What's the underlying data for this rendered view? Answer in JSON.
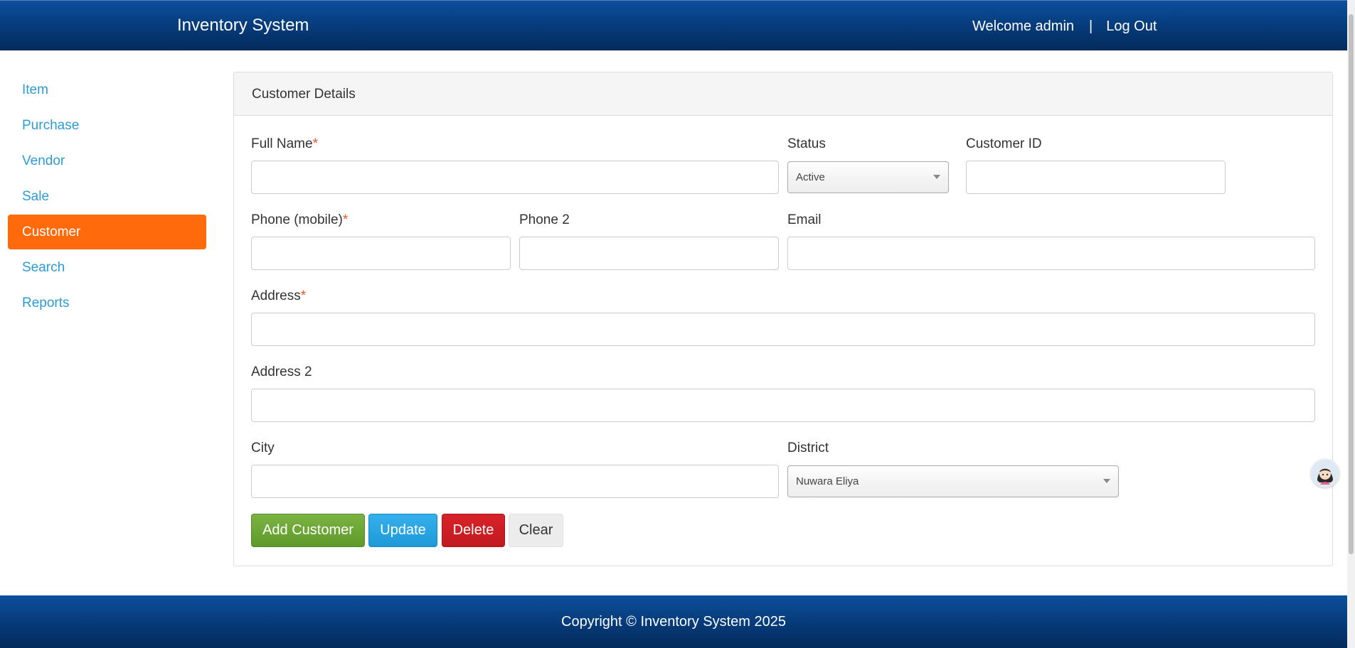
{
  "header": {
    "brand": "Inventory System",
    "welcome": "Welcome admin",
    "separator": "|",
    "logout": "Log Out"
  },
  "sidebar": {
    "items": [
      {
        "label": "Item"
      },
      {
        "label": "Purchase"
      },
      {
        "label": "Vendor"
      },
      {
        "label": "Sale"
      },
      {
        "label": "Customer",
        "active": true
      },
      {
        "label": "Search"
      },
      {
        "label": "Reports"
      }
    ]
  },
  "form": {
    "title": "Customer Details",
    "required_mark": "*",
    "full_name": {
      "label": "Full Name",
      "value": ""
    },
    "status": {
      "label": "Status",
      "value": "Active"
    },
    "customer_id": {
      "label": "Customer ID",
      "value": ""
    },
    "phone_mobile": {
      "label": "Phone (mobile)",
      "value": ""
    },
    "phone2": {
      "label": "Phone 2",
      "value": ""
    },
    "email": {
      "label": "Email",
      "value": ""
    },
    "address": {
      "label": "Address",
      "value": ""
    },
    "address2": {
      "label": "Address 2",
      "value": ""
    },
    "city": {
      "label": "City",
      "value": ""
    },
    "district": {
      "label": "District",
      "value": "Nuwara Eliya"
    }
  },
  "buttons": {
    "add": "Add Customer",
    "update": "Update",
    "delete": "Delete",
    "clear": "Clear"
  },
  "footer": {
    "copyright": "Copyright © Inventory System 2025"
  },
  "colors": {
    "header_blue": "#063a78",
    "active_orange": "#ff6a0c",
    "link_blue": "#2d9cd6",
    "required_red": "#e8562a",
    "add_green": "#6aa635",
    "update_blue": "#29a6e4",
    "delete_red": "#d11f25"
  },
  "icons": {
    "avatar": "chat-assistant-avatar-icon",
    "select_arrow": "chevron-down-icon"
  }
}
